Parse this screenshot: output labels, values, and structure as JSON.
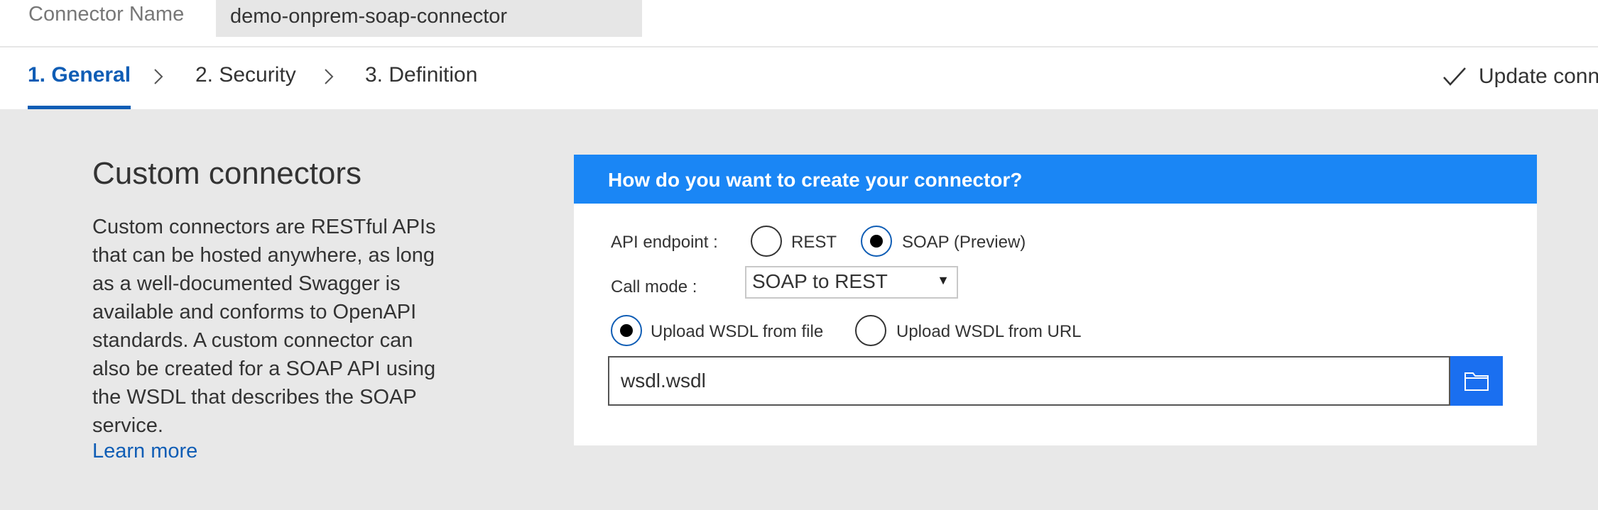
{
  "header": {
    "name_label": "Connector Name",
    "name_value": "demo-onprem-soap-connector"
  },
  "tabs": [
    {
      "label": "1. General",
      "active": true
    },
    {
      "label": "2. Security",
      "active": false
    },
    {
      "label": "3. Definition",
      "active": false
    }
  ],
  "update_button": {
    "label": "Update connector",
    "icon": "check-icon"
  },
  "intro": {
    "title": "Custom connectors",
    "text": "Custom connectors are RESTful APIs that can be hosted anywhere, as long as a well-documented Swagger is available and conforms to OpenAPI standards. A custom connector can also be created for a SOAP API using the WSDL that describes the SOAP service.",
    "learn_more": "Learn more"
  },
  "panel": {
    "header": "How do you want to create your connector?",
    "api_endpoint": {
      "label": "API endpoint :",
      "options": [
        "REST",
        "SOAP (Preview)"
      ],
      "selected": "SOAP (Preview)"
    },
    "call_mode": {
      "label": "Call mode :",
      "value": "SOAP to REST"
    },
    "wsdl_source": {
      "options": [
        "Upload WSDL from file",
        "Upload WSDL from URL"
      ],
      "selected": "Upload WSDL from file"
    },
    "file_value": "wsdl.wsdl",
    "browse_icon": "folder-icon"
  },
  "colors": {
    "accent": "#0f5db5",
    "panel_header": "#1a86f5",
    "browse_button": "#1a6ff0",
    "background": "#e8e8e8"
  }
}
